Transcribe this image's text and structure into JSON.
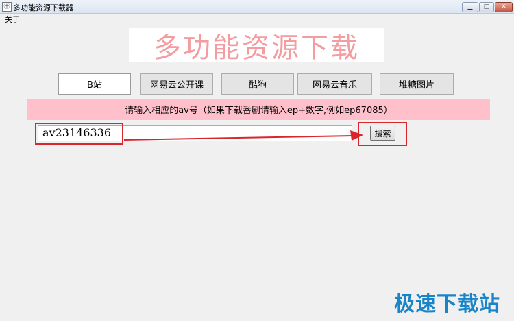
{
  "window": {
    "title": "多功能资源下载器",
    "controls": {
      "minimize": "▁",
      "maximize": "□",
      "close": "✕"
    }
  },
  "menu": {
    "items": [
      "关于"
    ]
  },
  "logo": {
    "text": "多功能资源下载"
  },
  "tabs": [
    {
      "label": "B站",
      "active": true
    },
    {
      "label": "网易云公开课",
      "active": false
    },
    {
      "label": "酷狗",
      "active": false
    },
    {
      "label": "网易云音乐",
      "active": false
    },
    {
      "label": "堆糖图片",
      "active": false
    }
  ],
  "banner": {
    "text": "请输入相应的av号（如果下载番剧请输入ep+数字,例如ep67085）"
  },
  "search": {
    "value": "av23146336",
    "button_label": "搜索"
  },
  "watermark": {
    "text": "极速下载站"
  },
  "colors": {
    "banner_bg": "#ffc0cb",
    "logo_text": "#f49ca0",
    "annotation_red": "#d9252b",
    "watermark": "#1a84c8"
  }
}
